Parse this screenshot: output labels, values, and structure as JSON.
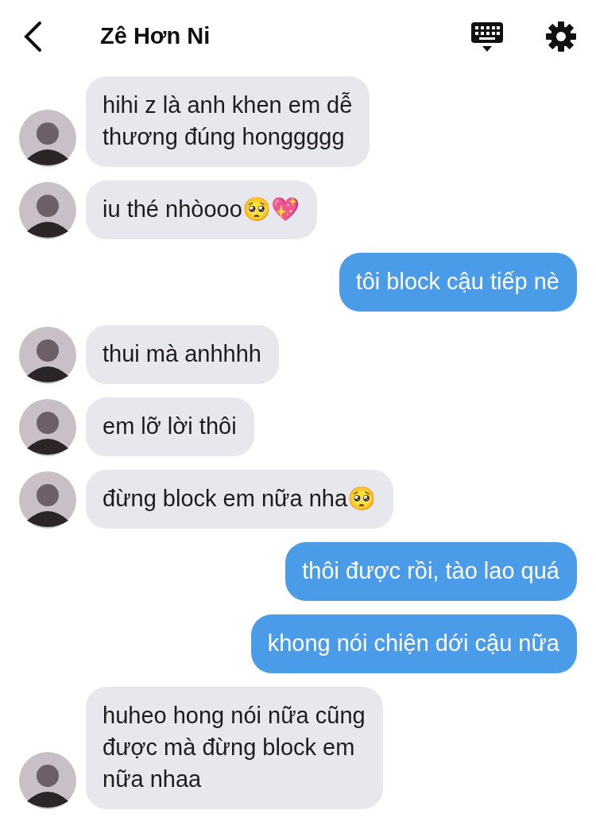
{
  "header": {
    "title": "Zê Hơn Ni"
  },
  "messages": [
    {
      "kind": "incoming",
      "text": "hihi z là anh khen em dễ\nthương đúng honggggg"
    },
    {
      "kind": "incoming",
      "text": "iu thé nhòooo🥺💖"
    },
    {
      "kind": "outgoing",
      "text": "tôi block cậu tiếp nè"
    },
    {
      "kind": "incoming",
      "text": "thui mà anhhhh"
    },
    {
      "kind": "incoming",
      "text": "em lỡ lời thôi"
    },
    {
      "kind": "incoming",
      "text": "đừng block em nữa nha🥺"
    },
    {
      "kind": "outgoing",
      "text": "thôi được rồi, tào lao quá"
    },
    {
      "kind": "outgoing",
      "text": "khong nói chiện dới cậu nữa"
    },
    {
      "kind": "incoming",
      "text": "huheo hong nói nữa cũng\nđược mà đừng block em\nnữa nhaa"
    }
  ]
}
